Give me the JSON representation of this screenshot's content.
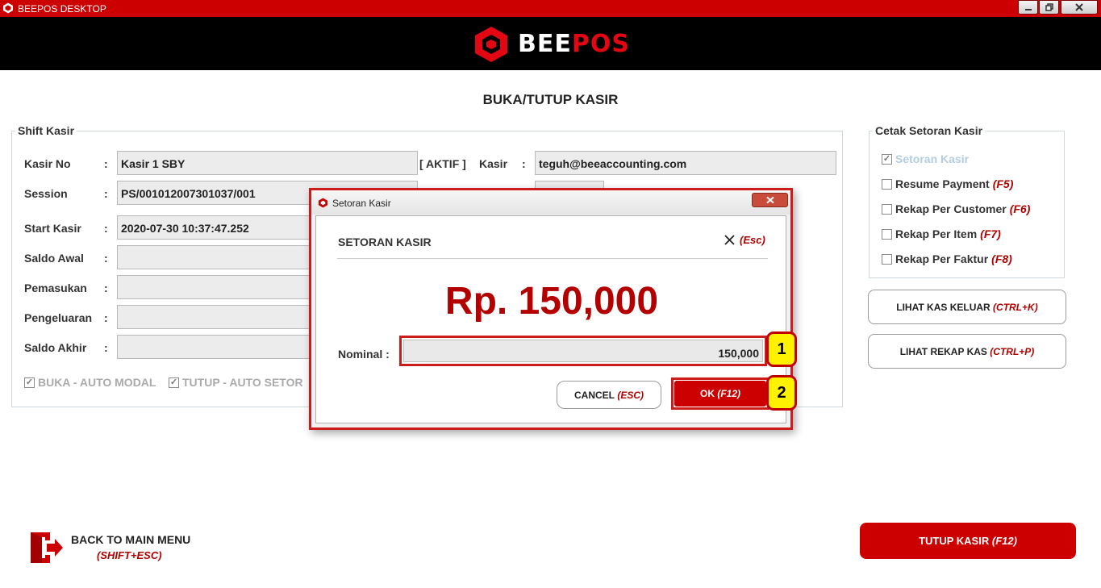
{
  "window": {
    "title": "BEEPOS DESKTOP"
  },
  "brand": {
    "logo_part1": "BEE",
    "logo_part2": "POS"
  },
  "page": {
    "title": "BUKA/TUTUP KASIR"
  },
  "shift": {
    "legend": "Shift Kasir",
    "colon": ":",
    "fields": {
      "kasir_no": {
        "label": "Kasir No",
        "value": "Kasir 1 SBY"
      },
      "status": "[ AKTIF ]",
      "kasir": {
        "label": "Kasir",
        "value": "teguh@beeaccounting.com"
      },
      "session": {
        "label": "Session",
        "value": "PS/001012007301037/001"
      },
      "start_kasir": {
        "label": "Start Kasir",
        "value": "2020-07-30 10:37:47.252"
      },
      "saldo_awal": {
        "label": "Saldo Awal",
        "value": ""
      },
      "pemasukan": {
        "label": "Pemasukan",
        "value": ""
      },
      "pengeluaran": {
        "label": "Pengeluaran",
        "value": ""
      },
      "saldo_akhir": {
        "label": "Saldo Akhir",
        "value": ""
      }
    },
    "options": {
      "buka_auto_modal": {
        "label": "BUKA - AUTO MODAL",
        "checked": true
      },
      "tutup_auto_setor": {
        "label": "TUTUP - AUTO SETOR",
        "checked": true
      }
    }
  },
  "cetak": {
    "legend": "Cetak Setoran Kasir",
    "items": [
      {
        "label": "Setoran Kasir",
        "shortcut": "",
        "checked": true
      },
      {
        "label": "Resume Payment",
        "shortcut": "(F5)",
        "checked": false
      },
      {
        "label": "Rekap Per Customer",
        "shortcut": "(F6)",
        "checked": false
      },
      {
        "label": "Rekap Per Item",
        "shortcut": "(F7)",
        "checked": false
      },
      {
        "label": "Rekap Per Faktur",
        "shortcut": "(F8)",
        "checked": false
      }
    ]
  },
  "side_buttons": {
    "lihat_kas_keluar": {
      "label": "LIHAT KAS KELUAR",
      "shortcut": "(CTRL+K)"
    },
    "lihat_rekap_kas": {
      "label": "LIHAT REKAP KAS",
      "shortcut": "(CTRL+P)"
    }
  },
  "back": {
    "label": "BACK TO MAIN MENU",
    "shortcut": "(SHIFT+ESC)"
  },
  "tutup_kasir": {
    "label": "TUTUP KASIR",
    "shortcut": "(F12)"
  },
  "dialog": {
    "window_title": "Setoran Kasir",
    "heading": "SETORAN KASIR",
    "close_shortcut": "(Esc)",
    "amount": "Rp. 150,000",
    "nominal_label": "Nominal :",
    "nominal_value": "150,000",
    "cancel": {
      "label": "CANCEL",
      "shortcut": "(ESC)"
    },
    "ok": {
      "label": "OK",
      "shortcut": "(F12)"
    }
  },
  "markers": [
    "1",
    "2"
  ],
  "colors": {
    "accent_red": "#cc0000",
    "amount_red": "#b30000",
    "marker_yellow": "#fff200"
  }
}
